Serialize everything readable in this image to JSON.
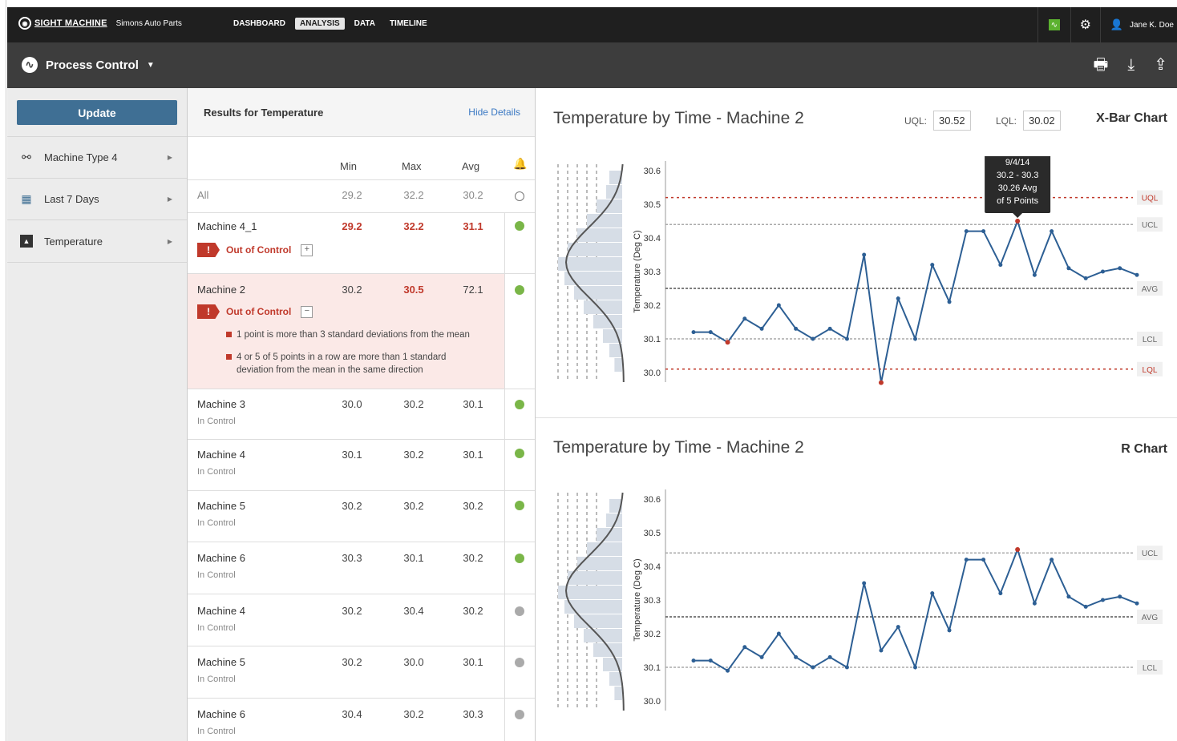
{
  "topbar": {
    "brand": "SIGHT MACHINE",
    "company": "Simons Auto Parts",
    "nav": [
      "DASHBOARD",
      "ANALYSIS",
      "DATA",
      "TIMELINE"
    ],
    "active_nav": "ANALYSIS",
    "user": "Jane K. Doe"
  },
  "subbar": {
    "title": "Process Control"
  },
  "sidebar": {
    "update_label": "Update",
    "items": [
      {
        "label": "Machine Type 4",
        "icon": "hierarchy-icon"
      },
      {
        "label": "Last 7 Days",
        "icon": "calendar-icon"
      },
      {
        "label": "Temperature",
        "icon": "chart-icon"
      }
    ]
  },
  "results": {
    "title": "Results for Temperature",
    "hide_details": "Hide Details",
    "columns": [
      "Min",
      "Max",
      "Avg"
    ],
    "all_row": {
      "name": "All",
      "min": "29.2",
      "max": "32.2",
      "avg": "30.2"
    },
    "rows": [
      {
        "name": "Machine 4_1",
        "status": "Out of Control",
        "min": "29.2",
        "max": "32.2",
        "avg": "31.1",
        "dot": "green"
      },
      {
        "name": "Machine 2",
        "status": "Out of Control",
        "min": "30.2",
        "max": "30.5",
        "avg": "72.1",
        "dot": "green",
        "details": [
          "1 point is more than 3 standard deviations from the mean",
          "4 or 5 of 5 points in a row are more than 1 standard deviation from the mean in the same direction"
        ]
      },
      {
        "name": "Machine 3",
        "status": "In Control",
        "min": "30.0",
        "max": "30.2",
        "avg": "30.1",
        "dot": "green"
      },
      {
        "name": "Machine 4",
        "status": "In Control",
        "min": "30.1",
        "max": "30.2",
        "avg": "30.1",
        "dot": "green"
      },
      {
        "name": "Machine 5",
        "status": "In Control",
        "min": "30.2",
        "max": "30.2",
        "avg": "30.2",
        "dot": "green"
      },
      {
        "name": "Machine 6",
        "status": "In Control",
        "min": "30.3",
        "max": "30.1",
        "avg": "30.2",
        "dot": "green"
      },
      {
        "name": "Machine 4",
        "status": "In Control",
        "min": "30.2",
        "max": "30.4",
        "avg": "30.2",
        "dot": "gray"
      },
      {
        "name": "Machine 5",
        "status": "In Control",
        "min": "30.2",
        "max": "30.0",
        "avg": "30.1",
        "dot": "gray"
      },
      {
        "name": "Machine 6",
        "status": "In Control",
        "min": "30.4",
        "max": "30.2",
        "avg": "30.3",
        "dot": "gray"
      }
    ]
  },
  "charts": {
    "xbar": {
      "title": "Temperature by Time - Machine 2",
      "type_label": "X-Bar Chart",
      "uql_label": "UQL:",
      "uql": "30.52",
      "lql_label": "LQL:",
      "lql": "30.02"
    },
    "r": {
      "title": "Temperature by Time - Machine 2",
      "type_label": "R Chart"
    },
    "tooltip": [
      "9/4/14",
      "30.2 - 30.3",
      "30.26 Avg",
      "of 5 Points"
    ]
  },
  "colors": {
    "line": "#2d5f94",
    "red": "#c0392b",
    "green": "#7ab648",
    "button": "#3f6f94"
  },
  "chart_data": [
    {
      "type": "line",
      "title": "Temperature by Time - Machine 2",
      "ylabel": "Temperature (Deg C)",
      "ylim": [
        30.0,
        30.6
      ],
      "yticks": [
        "30.6",
        "30.5",
        "30.4",
        "30.3",
        "30.2",
        "30.1",
        "30.0"
      ],
      "limits": [
        {
          "label": "UQL",
          "value": 30.52,
          "style": "red"
        },
        {
          "label": "UCL",
          "value": 30.44,
          "style": "gray"
        },
        {
          "label": "AVG",
          "value": 30.25,
          "style": "dark"
        },
        {
          "label": "LCL",
          "value": 30.1,
          "style": "gray"
        },
        {
          "label": "LQL",
          "value": 30.01,
          "style": "red"
        }
      ],
      "values": [
        30.12,
        30.12,
        30.09,
        30.16,
        30.13,
        30.2,
        30.13,
        30.1,
        30.13,
        30.1,
        30.35,
        29.97,
        30.22,
        30.1,
        30.32,
        30.21,
        30.42,
        30.42,
        30.32,
        30.45,
        30.29,
        30.42,
        30.31,
        30.28,
        30.3,
        30.31,
        30.29
      ],
      "highlight_indices": [
        2,
        11,
        19
      ],
      "histogram": [
        0.2,
        0.25,
        0.4,
        0.55,
        0.7,
        0.85,
        1.0,
        0.9,
        0.75,
        0.6,
        0.45,
        0.3,
        0.2,
        0.12
      ]
    },
    {
      "type": "line",
      "title": "Temperature by Time - Machine 2",
      "ylabel": "Temperature (Deg C)",
      "ylim": [
        30.0,
        30.6
      ],
      "yticks": [
        "30.6",
        "30.5",
        "30.4",
        "30.3",
        "30.2",
        "30.1",
        "30.0"
      ],
      "limits": [
        {
          "label": "UCL",
          "value": 30.44,
          "style": "gray"
        },
        {
          "label": "AVG",
          "value": 30.25,
          "style": "dark"
        },
        {
          "label": "LCL",
          "value": 30.1,
          "style": "gray"
        }
      ],
      "values": [
        30.12,
        30.12,
        30.09,
        30.16,
        30.13,
        30.2,
        30.13,
        30.1,
        30.13,
        30.1,
        30.35,
        30.15,
        30.22,
        30.1,
        30.32,
        30.21,
        30.42,
        30.42,
        30.32,
        30.45,
        30.29,
        30.42,
        30.31,
        30.28,
        30.3,
        30.31,
        30.29
      ],
      "highlight_indices": [
        19
      ],
      "histogram": [
        0.2,
        0.25,
        0.4,
        0.55,
        0.7,
        0.85,
        1.0,
        0.9,
        0.75,
        0.6,
        0.45,
        0.3,
        0.2,
        0.12
      ]
    }
  ]
}
